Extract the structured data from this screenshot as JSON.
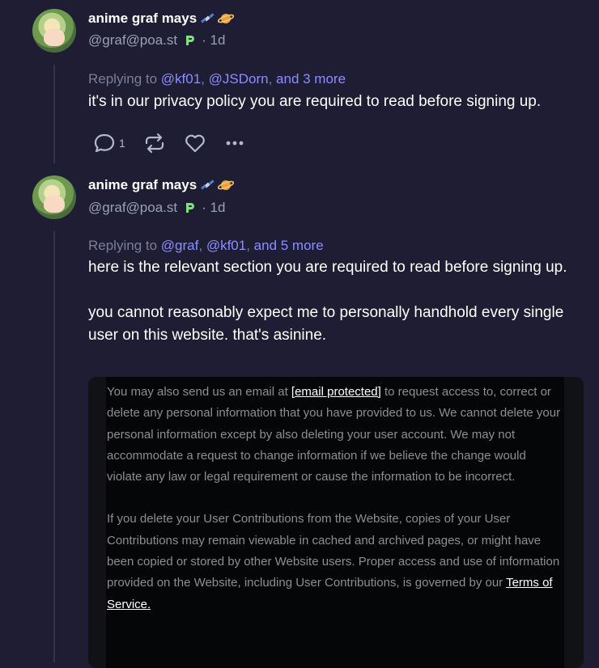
{
  "posts": [
    {
      "author": "anime graf mays",
      "handle": "@graf@poa.st",
      "age": "1d",
      "replying_prefix": "Replying to",
      "mentions": [
        "@kf01",
        "@JSDorn"
      ],
      "more": "and 3 more",
      "text": "it's in our privacy policy you are required to read before signing up.",
      "reply_count": "1"
    },
    {
      "author": "anime graf mays",
      "handle": "@graf@poa.st",
      "age": "1d",
      "replying_prefix": "Replying to",
      "mentions": [
        "@graf",
        "@kf01"
      ],
      "more": "and 5 more",
      "text_p1": "here is the relevant section you are required to read before signing up.",
      "text_p2": "you cannot reasonably expect me to personally handhold every single user on this website. that's asinine.",
      "embed": {
        "p1_before": "You may also send us an email at ",
        "p1_link": "[email protected]",
        "p1_after": " to request access to, correct or delete any personal information that you have provided to us. We cannot delete your personal information except by also deleting your user account. We may not accommodate a request to change information if we believe the change would violate any law or legal requirement or cause the information to be incorrect.",
        "p2_before": "If you delete your User Contributions from the Website, copies of your User Contributions may remain viewable in cached and archived pages, or might have been copied or stored by other Website users. Proper access and use of information provided on the Website, including User Contributions, is governed by our ",
        "p2_link": "Terms of Service."
      }
    }
  ],
  "icons": {
    "reply": "speech-bubble-icon",
    "repost": "repost-icon",
    "like": "heart-icon",
    "more": "ellipsis-icon"
  },
  "colors": {
    "background": "#1e1d33",
    "mention": "#8c8dff",
    "muted": "#9aa0b8"
  }
}
